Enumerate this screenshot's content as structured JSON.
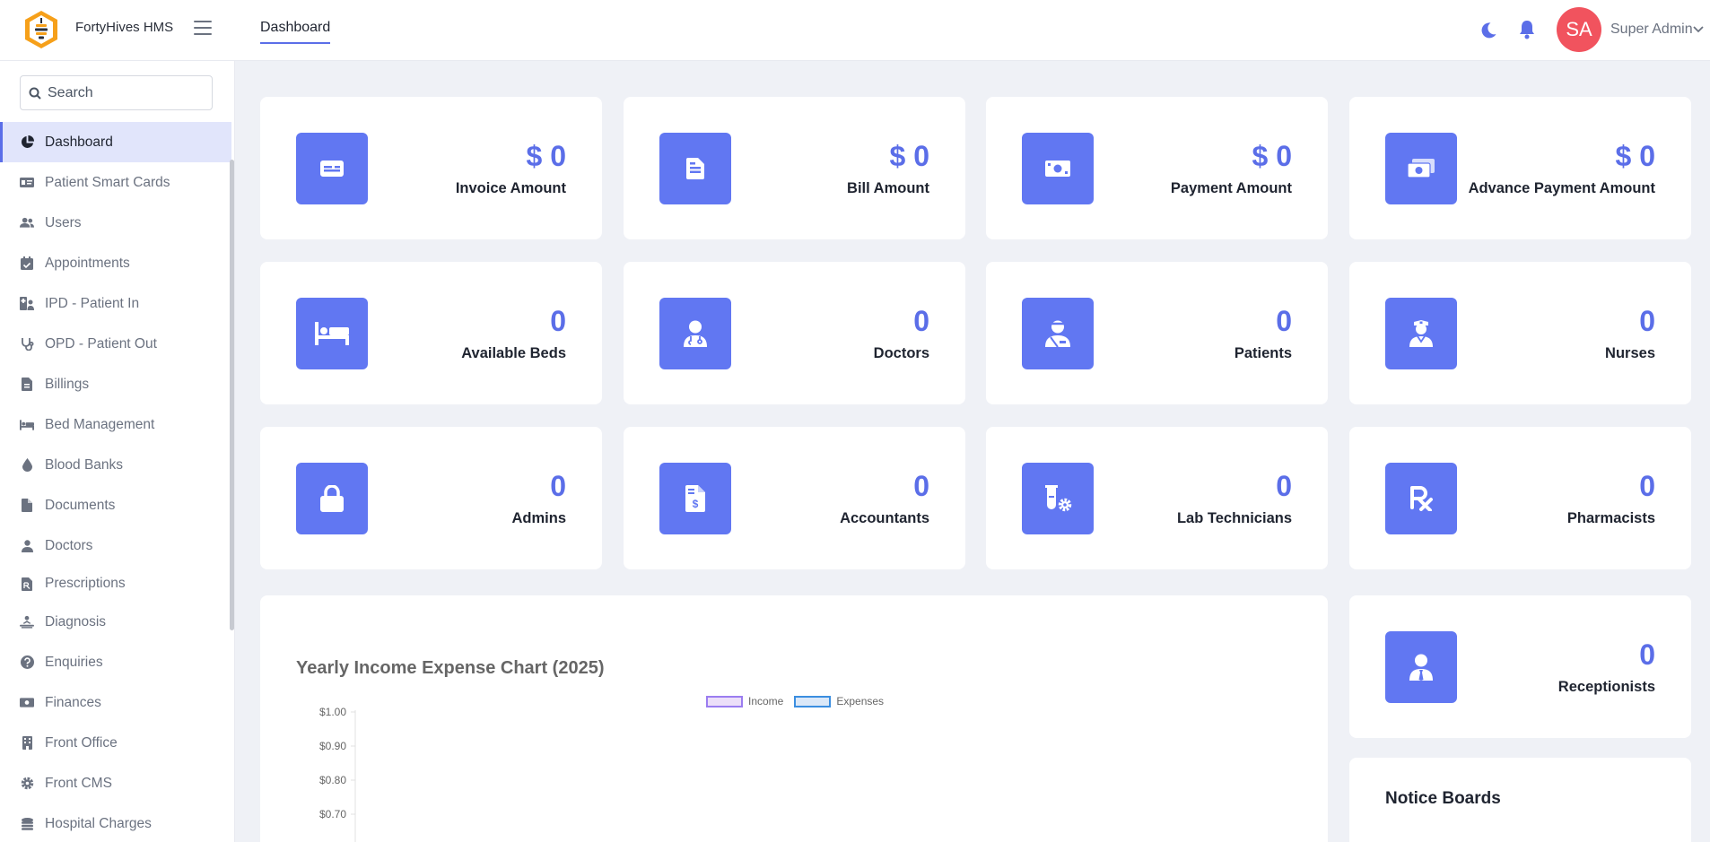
{
  "header": {
    "brand": "FortyHives HMS",
    "nav_tab": "Dashboard",
    "user_initials": "SA",
    "user_name": "Super Admin"
  },
  "sidebar": {
    "search_placeholder": "Search",
    "items": [
      {
        "label": "Dashboard",
        "icon": "pie-chart-icon",
        "active": true
      },
      {
        "label": "Patient Smart Cards",
        "icon": "id-card-icon"
      },
      {
        "label": "Users",
        "icon": "users-icon"
      },
      {
        "label": "Appointments",
        "icon": "calendar-check-icon"
      },
      {
        "label": "IPD - Patient In",
        "icon": "hospital-user-icon"
      },
      {
        "label": "OPD - Patient Out",
        "icon": "stethoscope-icon"
      },
      {
        "label": "Billings",
        "icon": "file-invoice-icon"
      },
      {
        "label": "Bed Management",
        "icon": "bed-icon"
      },
      {
        "label": "Blood Banks",
        "icon": "droplet-icon"
      },
      {
        "label": "Documents",
        "icon": "file-icon"
      },
      {
        "label": "Doctors",
        "icon": "user-doctor-icon"
      },
      {
        "label": "Prescriptions",
        "icon": "file-prescription-icon"
      },
      {
        "label": "Diagnosis",
        "icon": "diagnoses-icon"
      },
      {
        "label": "Enquiries",
        "icon": "question-circle-icon"
      },
      {
        "label": "Finances",
        "icon": "money-bill-icon"
      },
      {
        "label": "Front Office",
        "icon": "building-icon"
      },
      {
        "label": "Front CMS",
        "icon": "gear-icon"
      },
      {
        "label": "Hospital Charges",
        "icon": "coins-icon"
      }
    ]
  },
  "cards": [
    {
      "value": "$ 0",
      "label": "Invoice Amount",
      "icon": "money-card-icon"
    },
    {
      "value": "$ 0",
      "label": "Bill Amount",
      "icon": "bill-icon"
    },
    {
      "value": "$ 0",
      "label": "Payment Amount",
      "icon": "money-bill-icon"
    },
    {
      "value": "$ 0",
      "label": "Advance Payment Amount",
      "icon": "money-bills-icon"
    },
    {
      "value": "0",
      "label": "Available Beds",
      "icon": "bed-icon"
    },
    {
      "value": "0",
      "label": "Doctors",
      "icon": "user-doctor-icon"
    },
    {
      "value": "0",
      "label": "Patients",
      "icon": "user-injured-icon"
    },
    {
      "value": "0",
      "label": "Nurses",
      "icon": "user-nurse-icon"
    },
    {
      "value": "0",
      "label": "Admins",
      "icon": "lock-icon"
    },
    {
      "value": "0",
      "label": "Accountants",
      "icon": "file-invoice-dollar-icon"
    },
    {
      "value": "0",
      "label": "Lab Technicians",
      "icon": "vial-gear-icon"
    },
    {
      "value": "0",
      "label": "Pharmacists",
      "icon": "prescription-icon"
    },
    {
      "value": "0",
      "label": "Receptionists",
      "icon": "user-tie-icon"
    }
  ],
  "notice": {
    "title": "Notice Boards"
  },
  "colors": {
    "accent": "#5b6ee8",
    "icon_tile": "#6177f2",
    "avatar": "#f1535e"
  },
  "chart_data": {
    "type": "bar",
    "title": "Yearly Income Expense Chart (2025)",
    "series": [
      {
        "name": "Income",
        "values": []
      },
      {
        "name": "Expenses",
        "values": []
      }
    ],
    "y_tick_labels": [
      "$1.00",
      "$0.90",
      "$0.80",
      "$0.70"
    ],
    "ylim": [
      0,
      1
    ],
    "legend": "top-center",
    "series_colors": {
      "Income": "#9b7df0",
      "Expenses": "#3b8ee0"
    }
  }
}
